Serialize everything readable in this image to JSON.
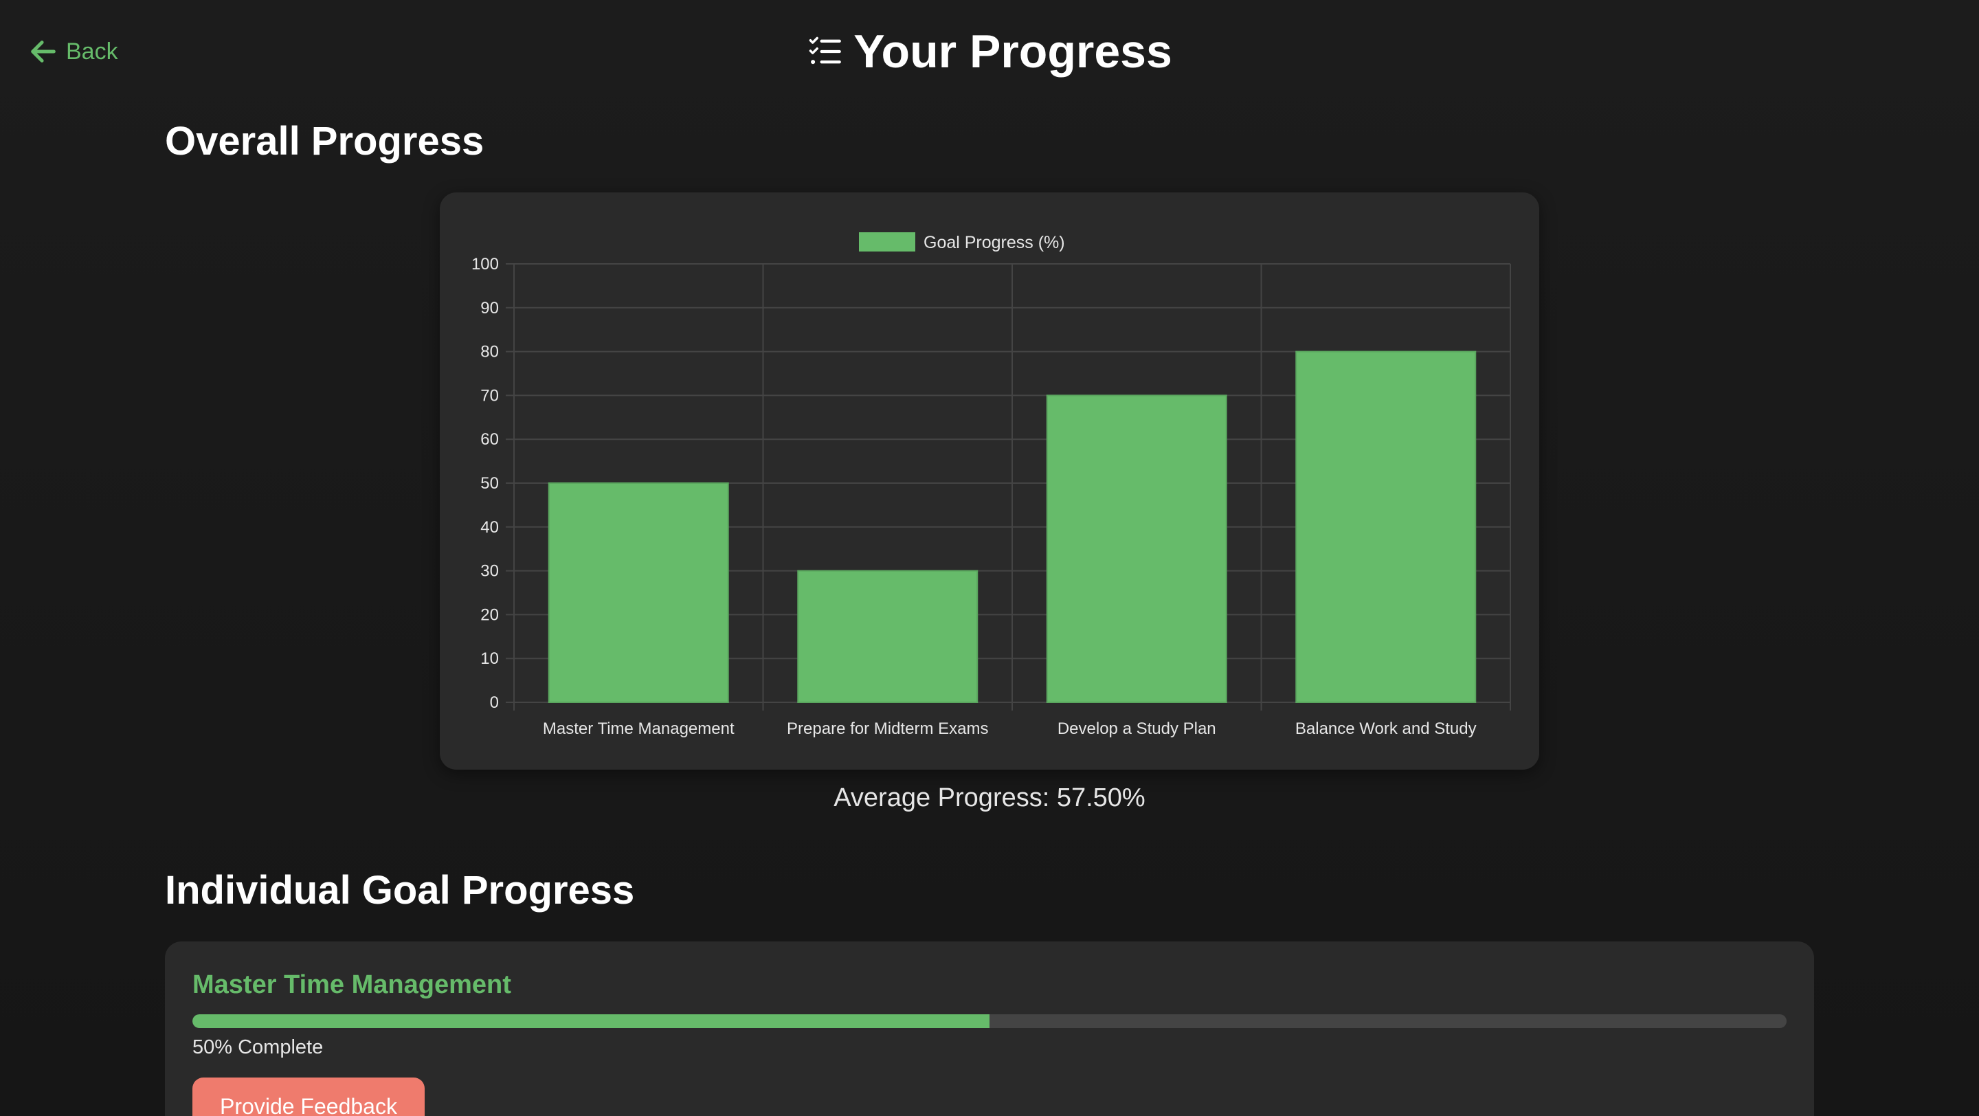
{
  "nav": {
    "back_label": "Back",
    "back_icon": "arrow-left-icon"
  },
  "header": {
    "title": "Your Progress",
    "title_icon": "checklist-icon"
  },
  "overall": {
    "heading": "Overall Progress",
    "average_text": "Average Progress: 57.50%"
  },
  "chart_data": {
    "type": "bar",
    "categories": [
      "Master Time Management",
      "Prepare for Midterm Exams",
      "Develop a Study Plan",
      "Balance Work and Study"
    ],
    "series": [
      {
        "name": "Goal Progress (%)",
        "values": [
          50,
          30,
          70,
          80
        ],
        "color": "#66bb6a"
      }
    ],
    "title": "",
    "xlabel": "",
    "ylabel": "",
    "ylim": [
      0,
      100
    ],
    "yticks": [
      "0",
      "10",
      "20",
      "30",
      "40",
      "50",
      "60",
      "70",
      "80",
      "90",
      "100"
    ],
    "grid": true,
    "legend_position": "top-center"
  },
  "individual": {
    "heading": "Individual Goal Progress",
    "goals": [
      {
        "title": "Master Time Management",
        "progress_fraction": 0.5,
        "status": "50% Complete",
        "feedback_label": "Provide Feedback"
      }
    ]
  },
  "colors": {
    "accent": "#66bb6a",
    "background": "#1a1a1a",
    "card": "#2a2a2a",
    "button": "#ef7b6d"
  }
}
